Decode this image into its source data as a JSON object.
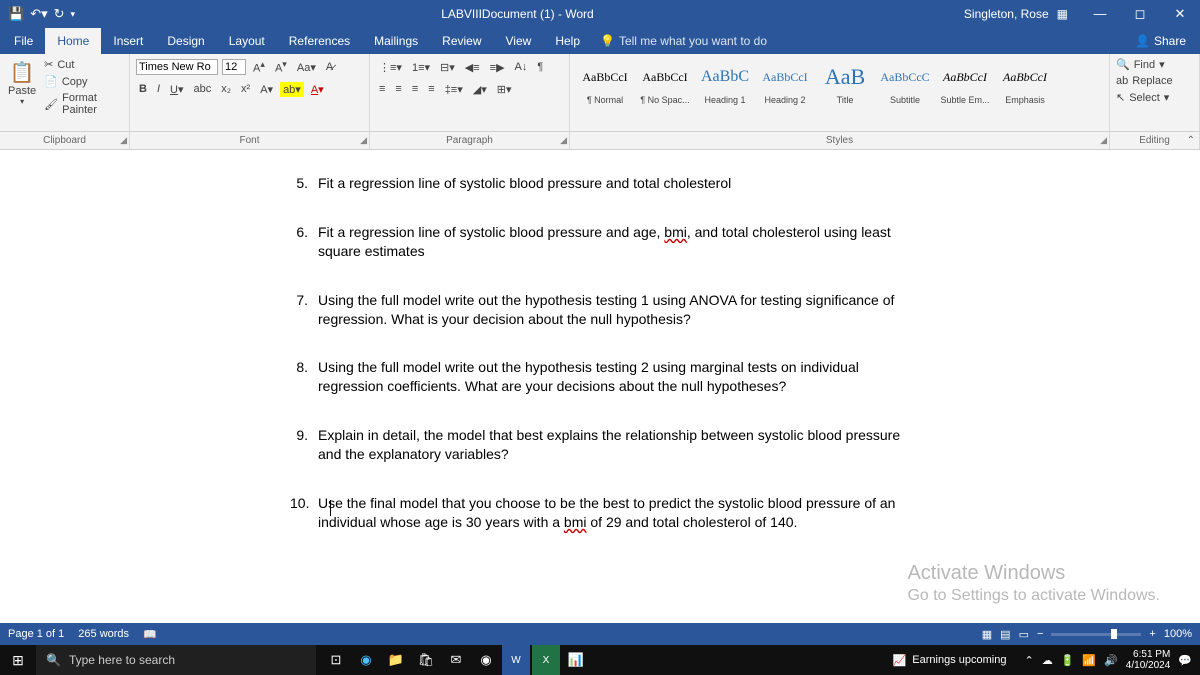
{
  "titlebar": {
    "title": "LABVIIIDocument (1) - Word",
    "user": "Singleton, Rose"
  },
  "tabs": [
    "File",
    "Home",
    "Insert",
    "Design",
    "Layout",
    "References",
    "Mailings",
    "Review",
    "View",
    "Help"
  ],
  "tell": "Tell me what you want to do",
  "share": "Share",
  "clipboard": {
    "paste": "Paste",
    "cut": "Cut",
    "copy": "Copy",
    "fp": "Format Painter",
    "label": "Clipboard"
  },
  "font": {
    "name": "Times New Ro",
    "size": "12",
    "label": "Font"
  },
  "paragraph": {
    "label": "Paragraph"
  },
  "styles": {
    "label": "Styles",
    "items": [
      {
        "prev": "AaBbCcI",
        "name": "¶ Normal"
      },
      {
        "prev": "AaBbCcI",
        "name": "¶ No Spac..."
      },
      {
        "prev": "AaBbC",
        "name": "Heading 1"
      },
      {
        "prev": "AaBbCcI",
        "name": "Heading 2"
      },
      {
        "prev": "AaB",
        "name": "Title"
      },
      {
        "prev": "AaBbCcC",
        "name": "Subtitle"
      },
      {
        "prev": "AaBbCcI",
        "name": "Subtle Em..."
      },
      {
        "prev": "AaBbCcI",
        "name": "Emphasis"
      }
    ]
  },
  "editing": {
    "find": "Find",
    "replace": "Replace",
    "select": "Select",
    "label": "Editing"
  },
  "doc": {
    "items": [
      {
        "n": "5.",
        "t": "Fit a regression line of systolic blood pressure and total cholesterol"
      },
      {
        "n": "6.",
        "t": "Fit a regression line of systolic blood pressure and age, <span class='wavy'>bmi</span>, and total cholesterol using least square estimates"
      },
      {
        "n": "7.",
        "t": "Using the full model write out the hypothesis testing 1 using ANOVA for testing significance of regression. What is your decision about the null hypothesis?"
      },
      {
        "n": "8.",
        "t": "Using the full model write out the hypothesis testing 2 using marginal tests on individual regression coefficients. What are your decisions about the null hypotheses?"
      },
      {
        "n": "9.",
        "t": "Explain in detail, the model that best explains the relationship between systolic blood pressure and the explanatory variables?"
      },
      {
        "n": "10.",
        "t": "Use the final model that you choose to be the best to predict the systolic blood pressure of an individual whose age is 30 years with a <span class='wavy'>bmi</span> of 29 and total cholesterol of 140."
      }
    ]
  },
  "watermark": {
    "title": "Activate Windows",
    "sub": "Go to Settings to activate Windows."
  },
  "status": {
    "page": "Page 1 of 1",
    "words": "265 words",
    "zoom": "100%"
  },
  "taskbar": {
    "search": "Type here to search",
    "news": "Earnings upcoming",
    "time": "6:51 PM",
    "date": "4/10/2024"
  }
}
